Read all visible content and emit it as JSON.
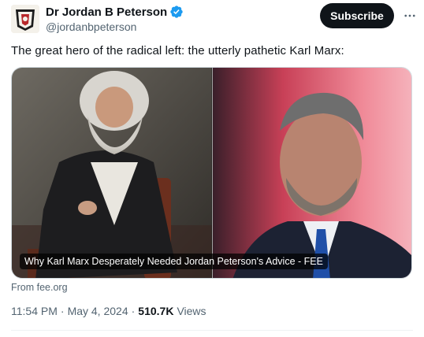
{
  "author": {
    "display_name": "Dr Jordan B Peterson",
    "handle": "@jordanbpeterson",
    "verified_icon": "verified-badge-icon",
    "verified_color": "#1d9bf0"
  },
  "actions": {
    "subscribe_label": "Subscribe",
    "more_icon": "more-dots-icon"
  },
  "tweet": {
    "text": "The great hero of the radical left: the utterly pathetic Karl Marx:"
  },
  "link_card": {
    "caption": "Why Karl Marx Desperately Needed Jordan Peterson's Advice - FEE",
    "source": "From fee.org"
  },
  "metadata": {
    "time": "11:54 PM",
    "separator": "·",
    "date": "May 4, 2024",
    "views_count": "510.7K",
    "views_label": "Views"
  },
  "colors": {
    "text_primary": "#0f1419",
    "text_secondary": "#536471",
    "subscribe_bg": "#0f1419"
  }
}
